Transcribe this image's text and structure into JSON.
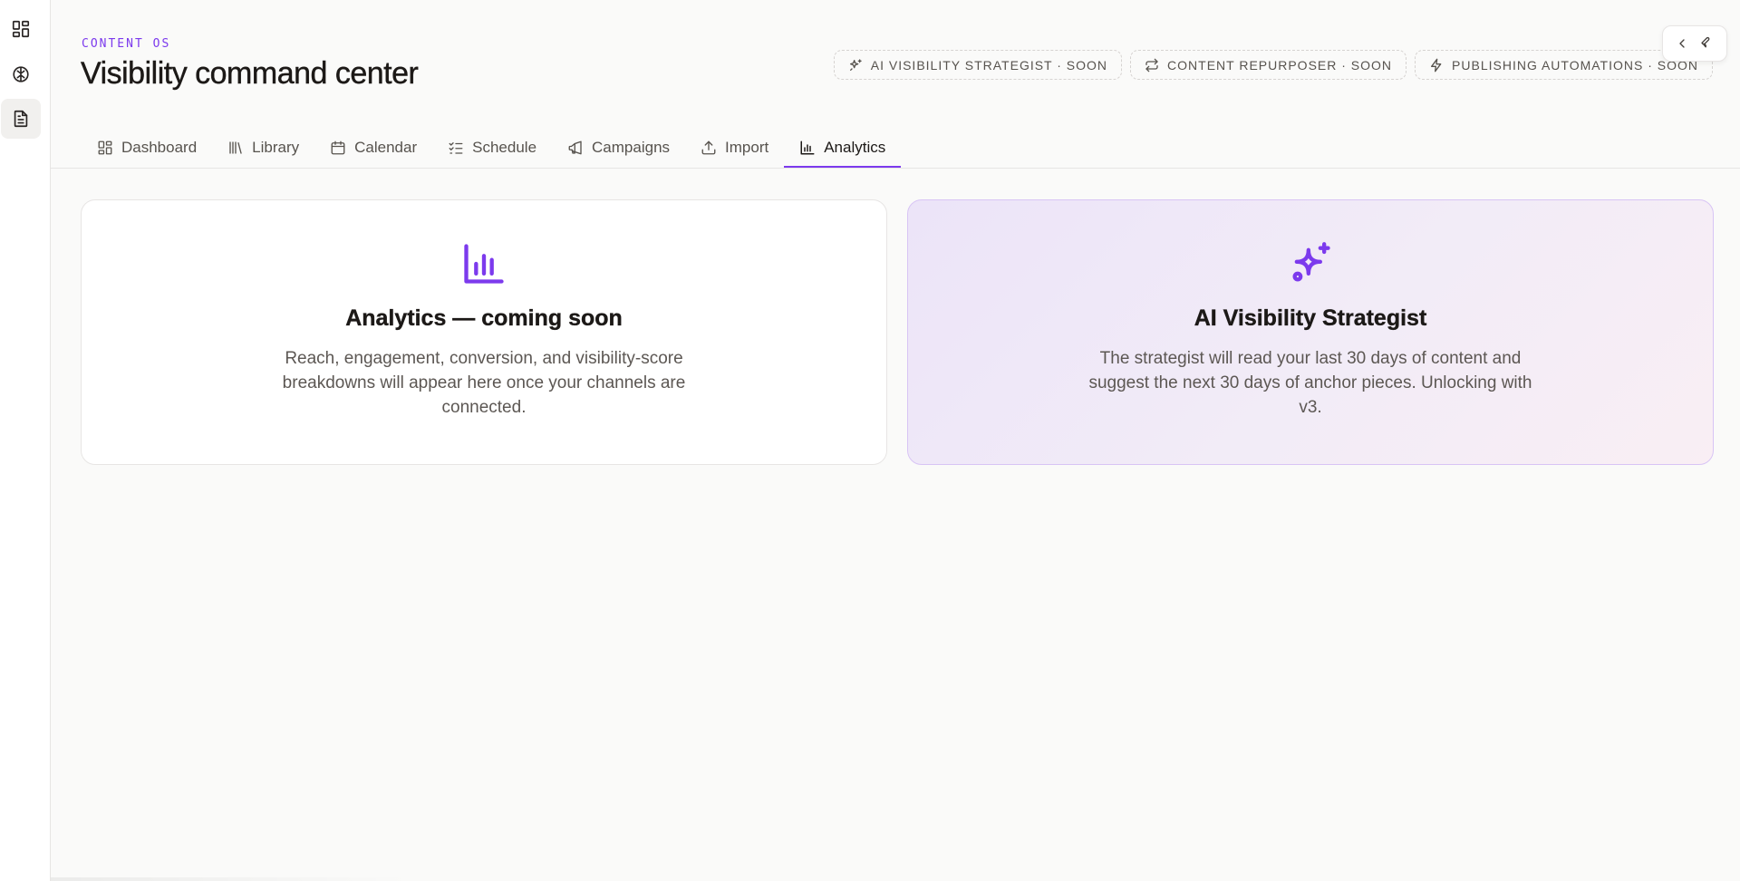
{
  "header": {
    "eyebrow": "CONTENT OS",
    "title": "Visibility command center"
  },
  "soon_pills": [
    {
      "icon": "sparkles-icon",
      "label": "AI VISIBILITY STRATEGIST · SOON"
    },
    {
      "icon": "repeat-icon",
      "label": "CONTENT REPURPOSER · SOON"
    },
    {
      "icon": "zap-icon",
      "label": "PUBLISHING AUTOMATIONS · SOON"
    }
  ],
  "rail": [
    {
      "icon": "layout-grid-icon",
      "active": false
    },
    {
      "icon": "brain-icon",
      "active": false
    },
    {
      "icon": "file-text-icon",
      "active": true
    }
  ],
  "tools": [
    {
      "icon": "chevron-left-icon"
    },
    {
      "icon": "wrench-icon"
    }
  ],
  "tabs": [
    {
      "label": "Dashboard",
      "icon": "dashboard-icon",
      "active": false
    },
    {
      "label": "Library",
      "icon": "library-icon",
      "active": false
    },
    {
      "label": "Calendar",
      "icon": "calendar-icon",
      "active": false
    },
    {
      "label": "Schedule",
      "icon": "list-checks-icon",
      "active": false
    },
    {
      "label": "Campaigns",
      "icon": "megaphone-icon",
      "active": false
    },
    {
      "label": "Import",
      "icon": "upload-icon",
      "active": false
    },
    {
      "label": "Analytics",
      "icon": "bar-chart-icon",
      "active": true
    }
  ],
  "cards": {
    "analytics": {
      "icon": "bar-chart-icon",
      "title": "Analytics — coming soon",
      "body": "Reach, engagement, conversion, and visibility-score breakdowns will appear here once your channels are connected."
    },
    "strategist": {
      "icon": "sparkles-icon",
      "title": "AI Visibility Strategist",
      "body": "The strategist will read your last 30 days of content and suggest the next 30 days of anchor pieces. Unlocking with v3."
    }
  },
  "colors": {
    "accent": "#7c3aed",
    "background": "#fafaf9",
    "card_border": "#e7e5e4",
    "accent_card_border": "#d8c4f5"
  }
}
